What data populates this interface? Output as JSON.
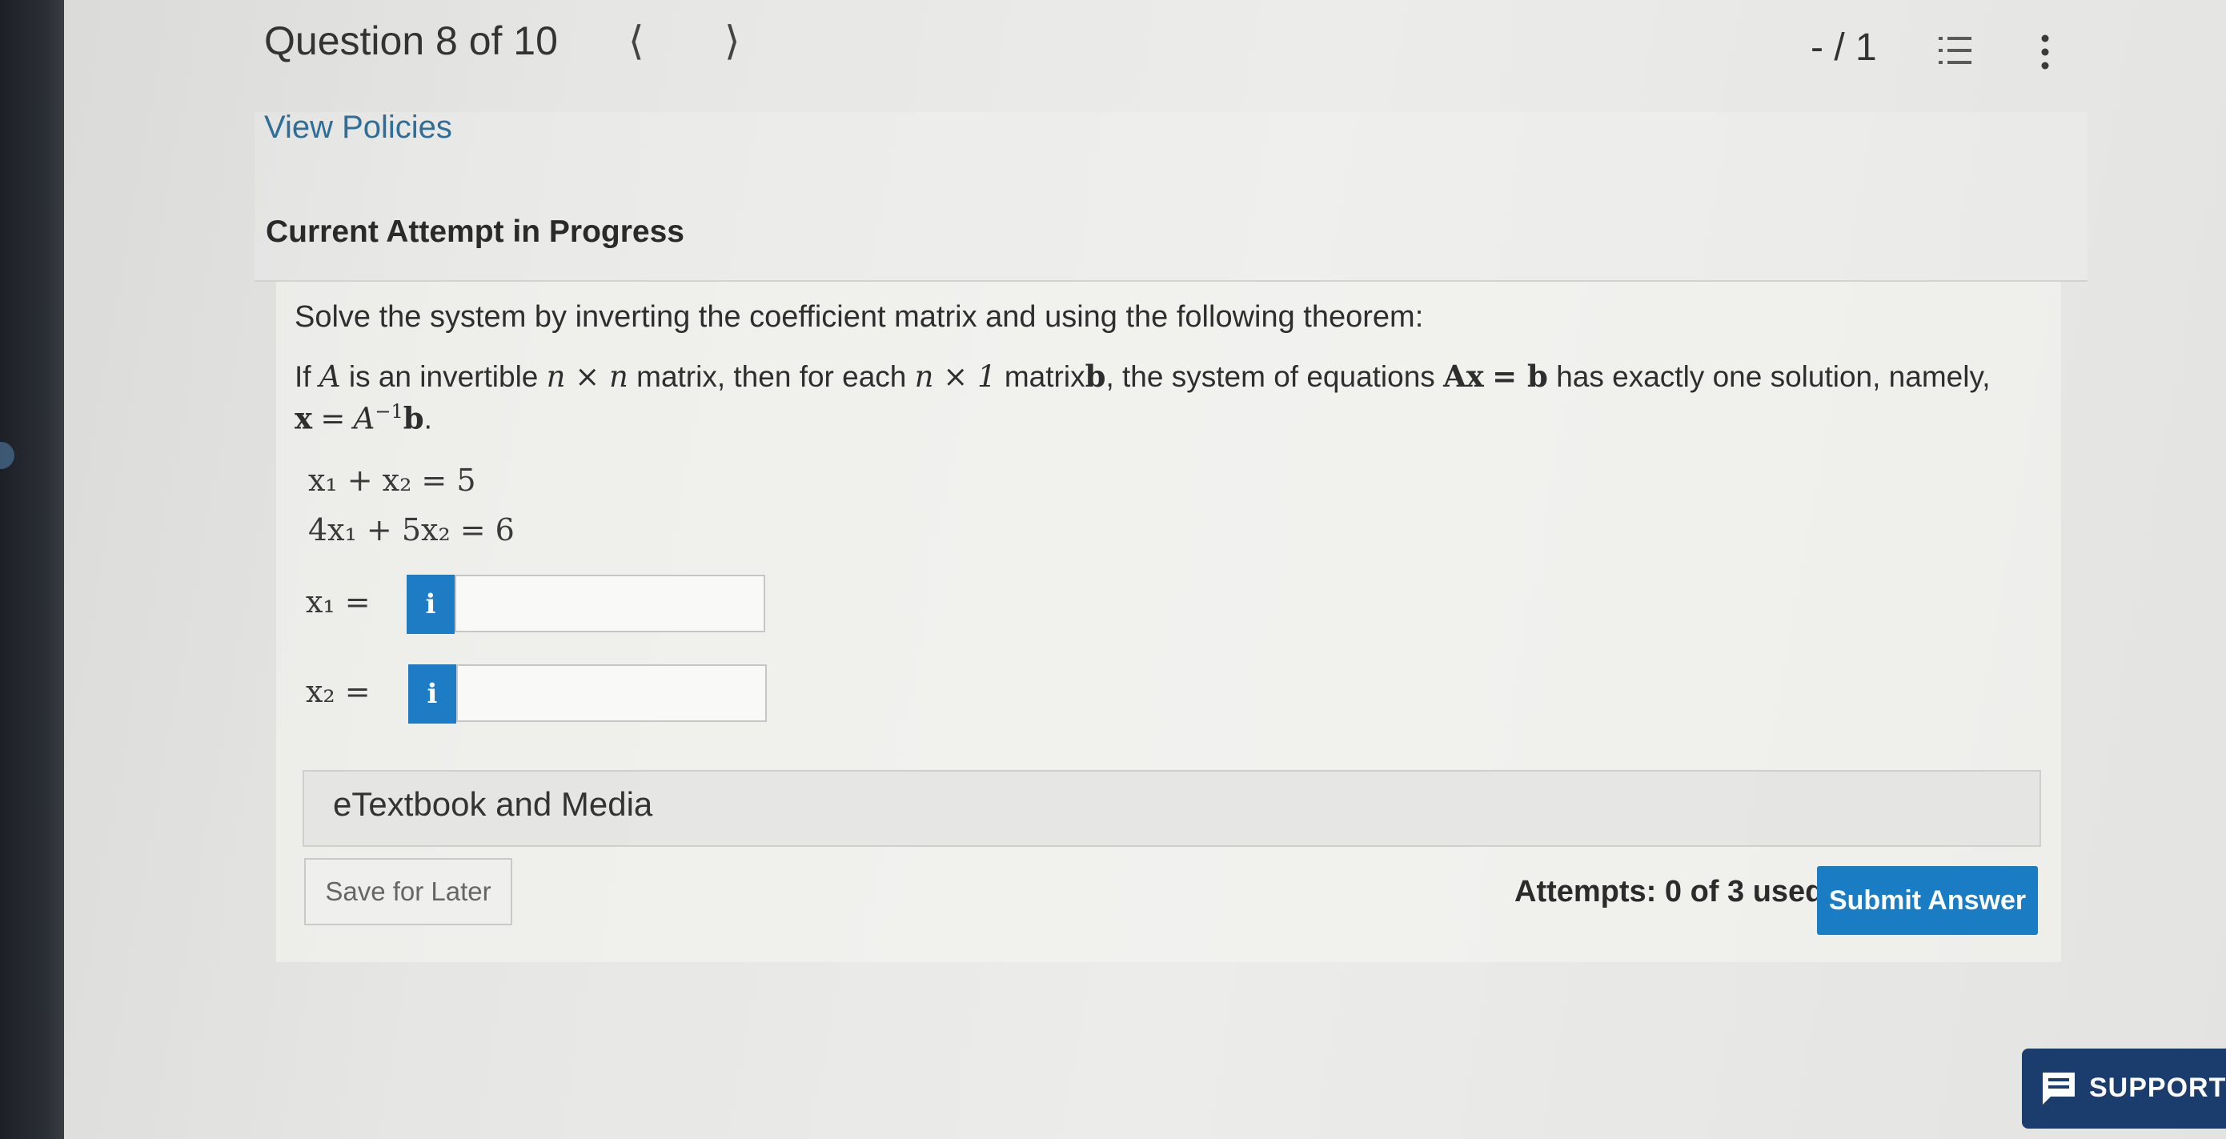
{
  "header": {
    "title": "Question 8 of 10",
    "prev_icon": "chevron-left-icon",
    "next_icon": "chevron-right-icon",
    "score": "- / 1",
    "list_icon": "numbered-list-icon",
    "more_icon": "more-vertical-icon"
  },
  "policies": {
    "link_label": "View Policies"
  },
  "attempt": {
    "heading": "Current Attempt in Progress"
  },
  "question": {
    "prompt": "Solve the system by inverting the coefficient matrix and using the following theorem:",
    "theorem": {
      "t_if": "If",
      "t_A": "A",
      "t_is": "is an invertible",
      "t_nxn": "n × n",
      "t_matrix_each": "matrix, then for each",
      "t_nx1": "n × 1",
      "t_matrix": "matrix",
      "t_b": "b",
      "t_system": ", the system of equations",
      "t_Ax": "Ax",
      "t_eqb": "= b",
      "t_has": "has exactly one solution, namely,",
      "t_x": "x",
      "t_eq": "=",
      "t_Ainv": "A",
      "t_sup": "−1",
      "t_b2": "b",
      "t_dot": "."
    },
    "equations": {
      "eq1": "x₁ + x₂ = 5",
      "eq2": "4x₁ + 5x₂ = 6"
    },
    "answers": [
      {
        "label": "x₁ =",
        "info": "i",
        "value": ""
      },
      {
        "label": "x₂ =",
        "info": "i",
        "value": ""
      }
    ]
  },
  "etextbook": {
    "label": "eTextbook and Media"
  },
  "footer": {
    "save_label": "Save for Later",
    "attempts_text": "Attempts: 0 of 3 used",
    "submit_label": "Submit Answer"
  },
  "support": {
    "label": "SUPPORT",
    "icon": "chat-icon"
  },
  "colors": {
    "accent": "#1a7cc2",
    "link": "#2e6e98",
    "support_bg": "#1b3d6e"
  }
}
